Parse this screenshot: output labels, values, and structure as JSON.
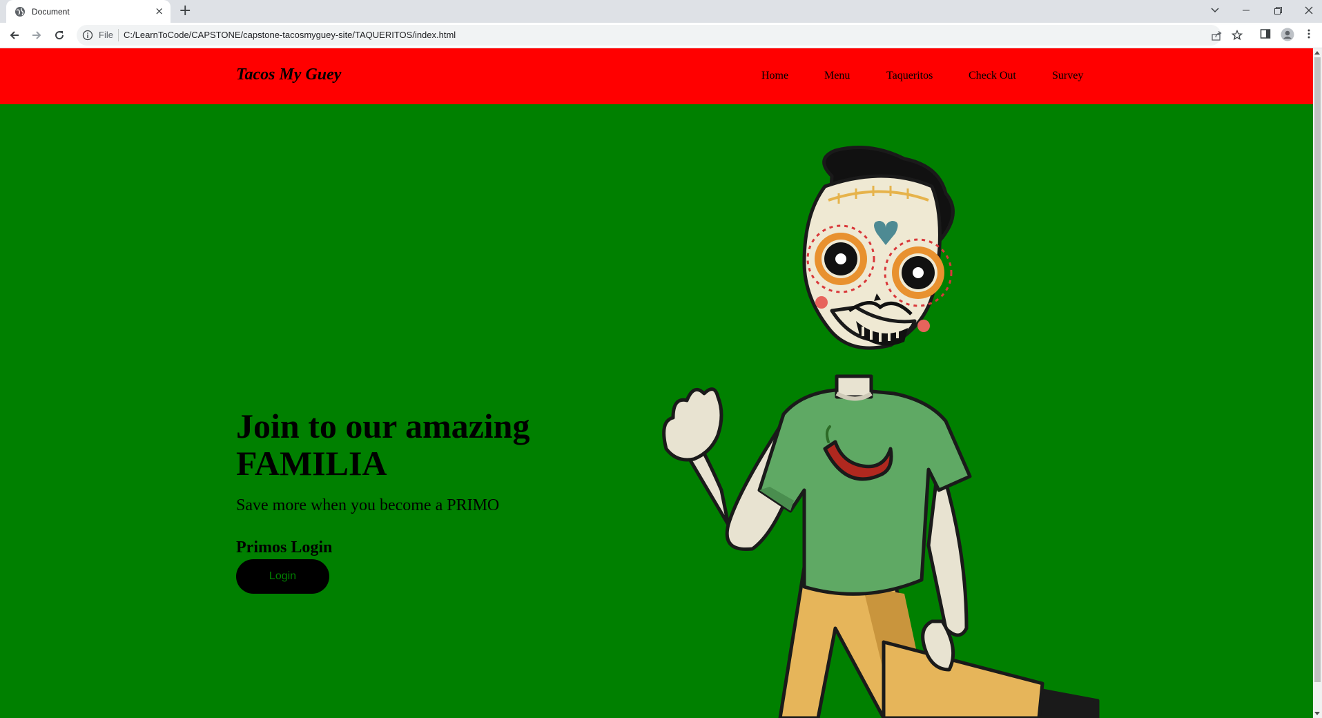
{
  "browser": {
    "tab_title": "Document",
    "tab_close": "×",
    "new_tab": "+",
    "address_scheme": "File",
    "address_url": "C:/LearnToCode/CAPSTONE/capstone-tacosmyguey-site/TAQUERITOS/index.html"
  },
  "header": {
    "brand": "Tacos My Guey",
    "nav": [
      {
        "label": "Home"
      },
      {
        "label": "Menu"
      },
      {
        "label": "Taqueritos"
      },
      {
        "label": "Check Out"
      },
      {
        "label": "Survey"
      }
    ]
  },
  "hero": {
    "title_line1": "Join to our amazing",
    "title_line2": "FAMILIA",
    "subtitle": "Save more when you become a PRIMO",
    "login_heading": "Primos Login",
    "login_button": "Login"
  },
  "colors": {
    "header_bg": "#ff0000",
    "page_bg": "#008000",
    "button_bg": "#000000",
    "button_text": "#008000"
  },
  "icons": {
    "tab_favicon": "globe-icon",
    "back": "arrow-left-icon",
    "forward": "arrow-right-icon",
    "reload": "reload-icon",
    "site_info": "info-icon",
    "share": "share-icon",
    "bookmark": "star-icon",
    "side_panel": "side-panel-icon",
    "profile": "profile-icon",
    "menu": "kebab-menu-icon",
    "mascot": "skeleton-mascot-illustration"
  }
}
